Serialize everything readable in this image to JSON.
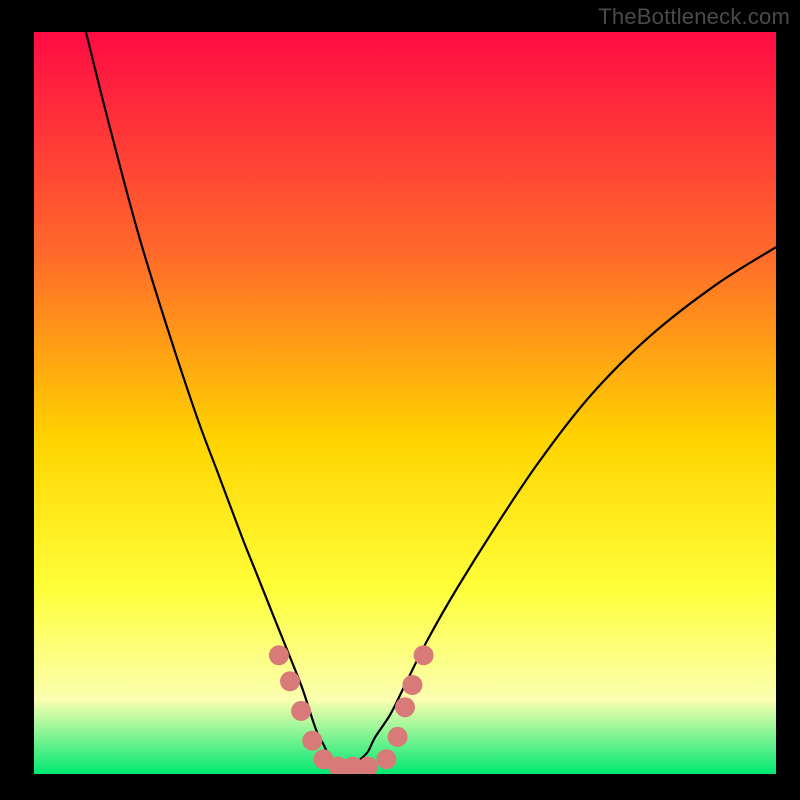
{
  "watermark": "TheBottleneck.com",
  "colors": {
    "frame": "#000000",
    "watermark": "#4a4a4a",
    "gradient_top": "#ff0b44",
    "gradient_mid1": "#ff6a2a",
    "gradient_mid2": "#ffd400",
    "gradient_mid3": "#ffff3a",
    "gradient_mid4": "#fbffb0",
    "gradient_bottom": "#00e873",
    "curve": "#000000",
    "dots": "#d87a77"
  },
  "chart_data": {
    "type": "line",
    "title": "",
    "xlabel": "",
    "ylabel": "",
    "xlim": [
      0,
      100
    ],
    "ylim": [
      0,
      100
    ],
    "series": [
      {
        "name": "bottleneck-curve",
        "x": [
          7,
          10,
          14,
          18,
          22,
          25,
          28,
          30,
          32,
          34,
          36,
          37,
          38,
          39,
          40,
          41,
          42,
          43,
          44,
          45,
          46,
          48,
          50,
          53,
          57,
          62,
          68,
          75,
          83,
          92,
          100
        ],
        "y": [
          100,
          88,
          73,
          60,
          48,
          40,
          32,
          27,
          22,
          17,
          12,
          9,
          6,
          4,
          2,
          1,
          1,
          1,
          2,
          3,
          5,
          8,
          12,
          18,
          25,
          33,
          42,
          51,
          59,
          66,
          71
        ]
      }
    ],
    "markers": [
      {
        "x": 33.0,
        "y": 16.0
      },
      {
        "x": 34.5,
        "y": 12.5
      },
      {
        "x": 36.0,
        "y": 8.5
      },
      {
        "x": 37.5,
        "y": 4.5
      },
      {
        "x": 39.0,
        "y": 2.0
      },
      {
        "x": 41.0,
        "y": 1.0
      },
      {
        "x": 43.0,
        "y": 1.0
      },
      {
        "x": 45.0,
        "y": 1.0
      },
      {
        "x": 47.5,
        "y": 2.0
      },
      {
        "x": 49.0,
        "y": 5.0
      },
      {
        "x": 50.0,
        "y": 9.0
      },
      {
        "x": 51.0,
        "y": 12.0
      },
      {
        "x": 52.5,
        "y": 16.0
      }
    ]
  }
}
